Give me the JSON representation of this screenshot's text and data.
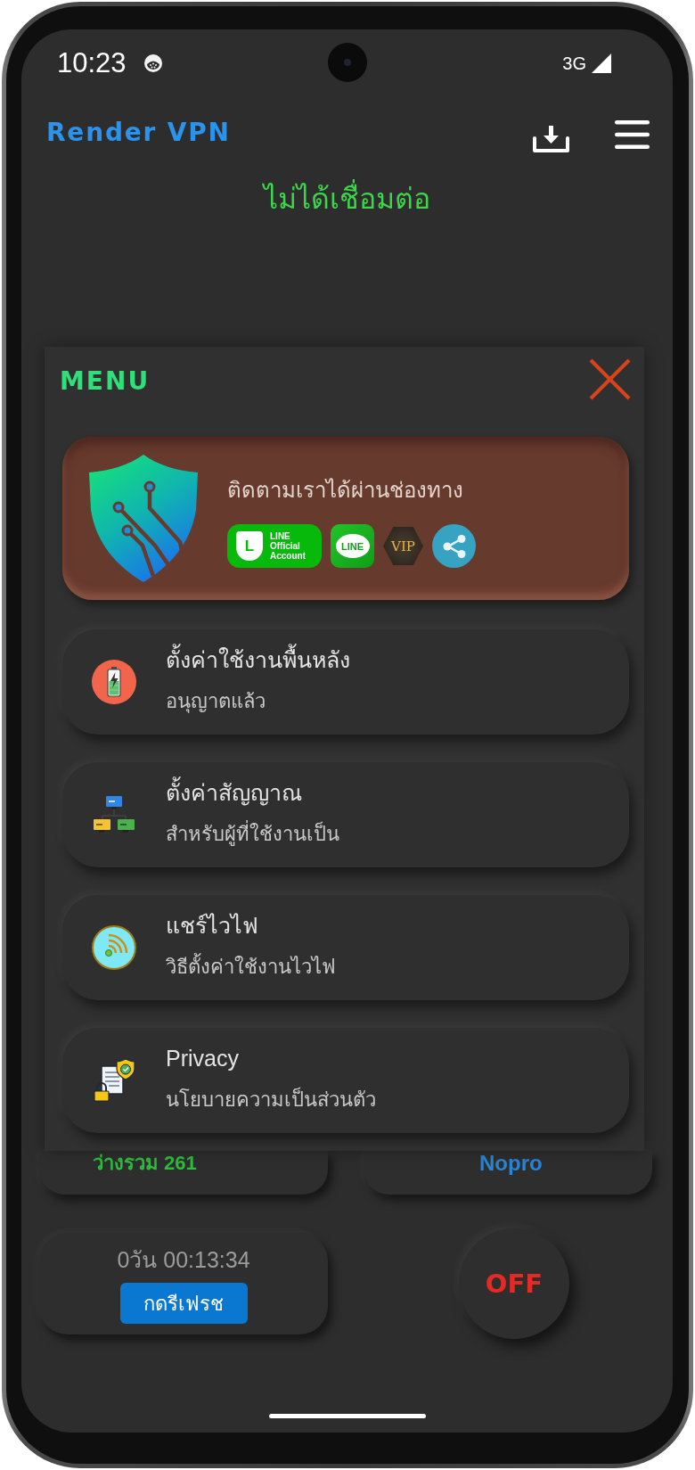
{
  "status_bar": {
    "time": "10:23",
    "network": "3G"
  },
  "header": {
    "title": "Render VPN"
  },
  "connection_status": "ไม่ได้เชื่อมต่อ",
  "menu": {
    "title": "MENU",
    "follow_banner": {
      "text": "ติดตามเราได้ผ่านช่องทาง",
      "channels": [
        {
          "kind": "line_official",
          "mark": "L",
          "label": "LINE Official Account"
        },
        {
          "kind": "line",
          "label": "LINE"
        },
        {
          "kind": "vip",
          "label": "VIP"
        },
        {
          "kind": "share"
        }
      ]
    },
    "items": [
      {
        "kind": "battery",
        "title": "ตั้งค่าใช้งานพื้นหลัง",
        "subtitle": "อนุญาตแล้ว"
      },
      {
        "kind": "network",
        "title": "ตั้งค่าสัญญาณ",
        "subtitle": "สำหรับผู้ที่ใช้งานเป็น"
      },
      {
        "kind": "wifi",
        "title": "แชร์ไวไฟ",
        "subtitle": "วิธีตั้งค่าใช้งานไวไฟ"
      },
      {
        "kind": "privacy",
        "title": "Privacy",
        "subtitle": "นโยบายความเป็นส่วนตัว"
      }
    ]
  },
  "stats": [
    {
      "kind": "free",
      "text": "ว่างรวม 261"
    },
    {
      "kind": "plan",
      "text": "Nopro"
    }
  ],
  "session": {
    "elapsed": "0วัน 00:13:34",
    "refresh_button": "กดรีเฟรช"
  },
  "power_button": {
    "label": "OFF",
    "on": false
  }
}
